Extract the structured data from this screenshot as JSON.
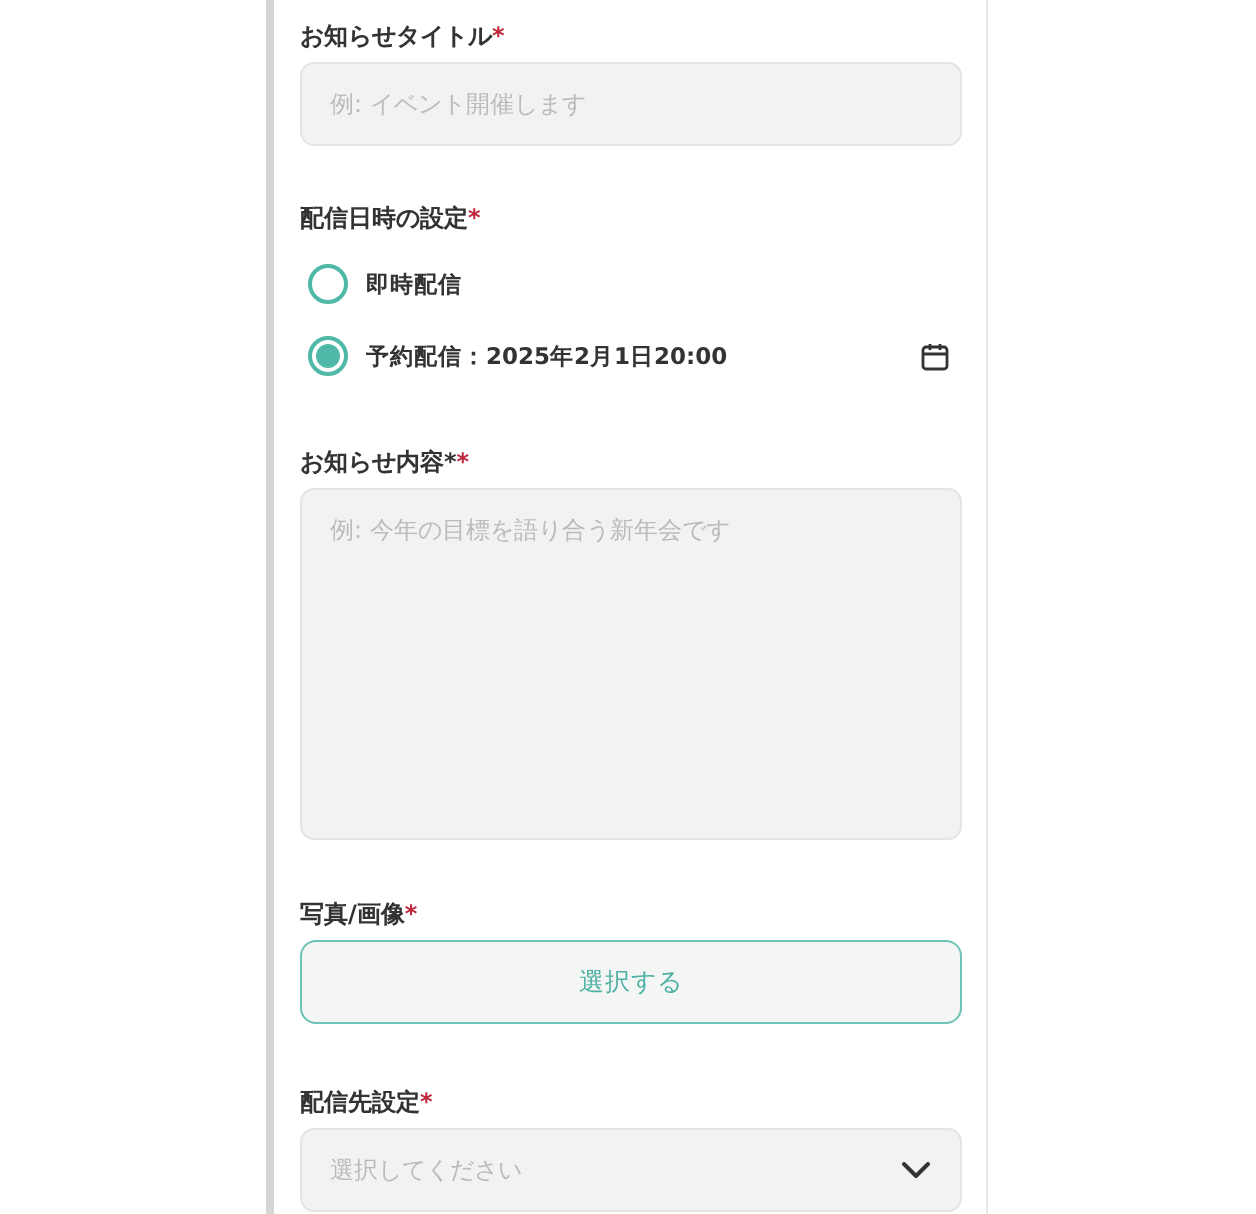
{
  "fields": [
    {
      "kind": "text",
      "label": "お知らせタイトル",
      "required_mark": "*",
      "placeholder": "例: イベント開催します"
    },
    {
      "kind": "radio",
      "label": "配信日時の設定",
      "required_mark": "*",
      "options": [
        {
          "label": "即時配信",
          "selected": false
        },
        {
          "label": "予約配信：2025年2月1日20:00",
          "selected": true,
          "calendar": true
        }
      ]
    },
    {
      "kind": "textarea",
      "label": "お知らせ内容*",
      "required_mark": "*",
      "placeholder": "例: 今年の目標を語り合う新年会です"
    },
    {
      "kind": "button",
      "label": "写真/画像",
      "required_mark": "*",
      "button": "選択する"
    },
    {
      "kind": "select",
      "label": "配信先設定",
      "required_mark": "*",
      "placeholder": "選択してください"
    }
  ]
}
